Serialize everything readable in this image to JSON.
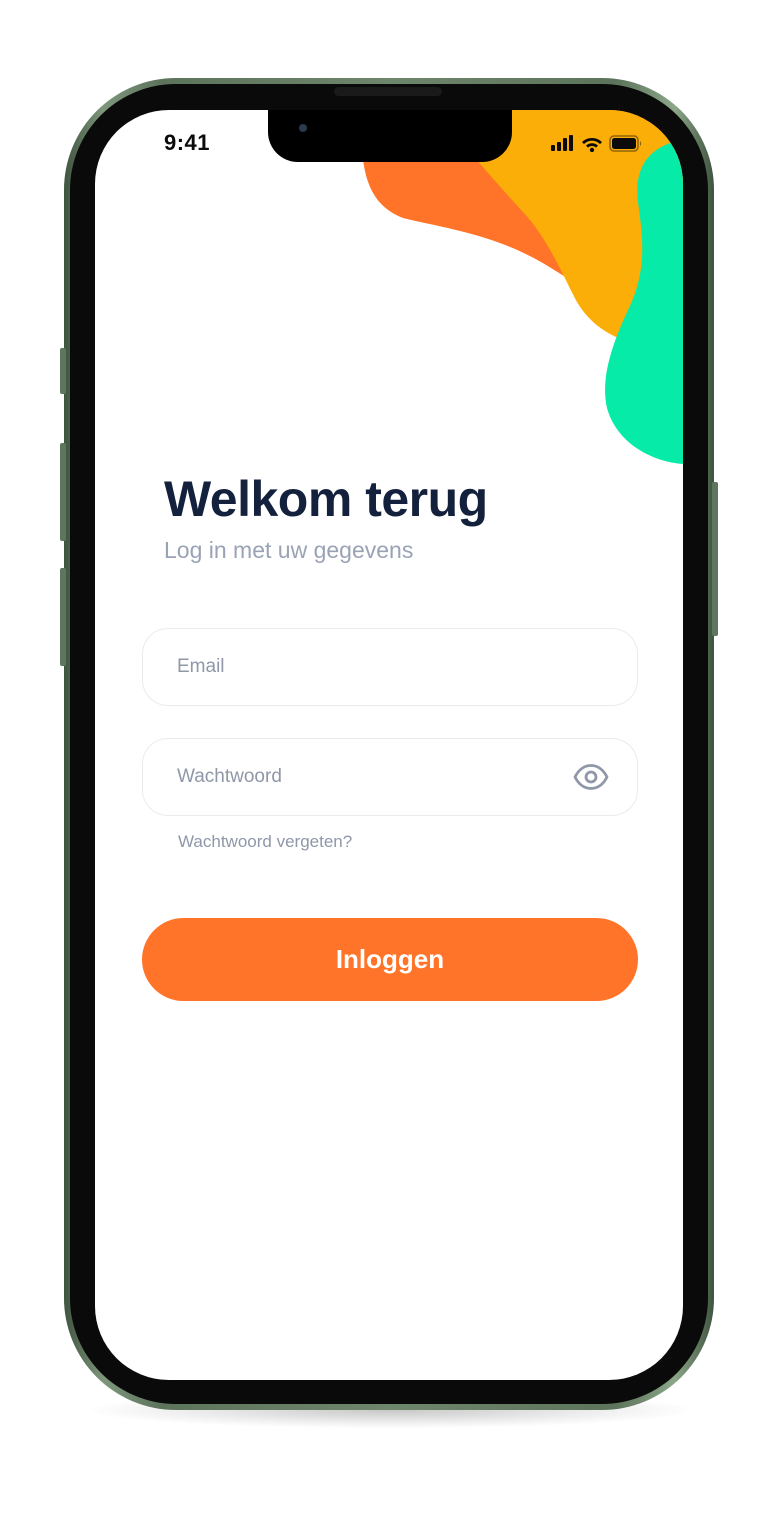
{
  "status_bar": {
    "time": "9:41",
    "icons": [
      "cellular-signal-icon",
      "wifi-icon",
      "battery-icon"
    ]
  },
  "login": {
    "title": "Welkom terug",
    "subtitle": "Log in met uw gegevens",
    "email_placeholder": "Email",
    "password_placeholder": "Wachtwoord",
    "forgot_password": "Wachtwoord vergeten?",
    "submit_label": "Inloggen"
  },
  "colors": {
    "primary": "#ff7428",
    "title_text": "#14213d",
    "muted_text": "#9aa3b5",
    "blob_orange": "#ff7428",
    "blob_yellow": "#fbad08",
    "blob_green": "#06eca8",
    "device_frame": "#6e866c"
  }
}
